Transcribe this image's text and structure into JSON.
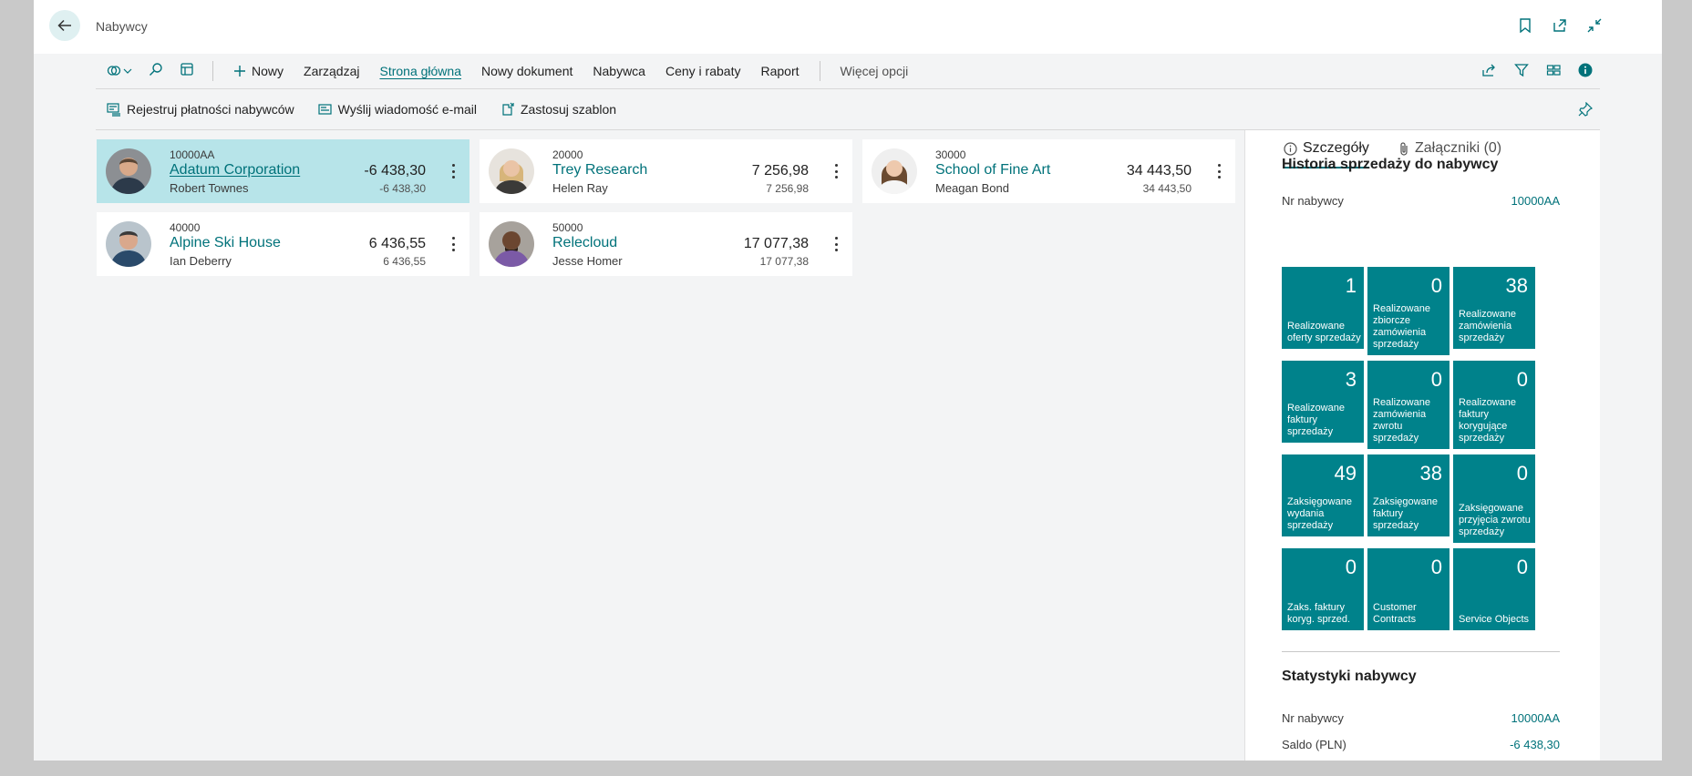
{
  "window": {
    "title": "Nabywcy"
  },
  "actions": {
    "new": "Nowy",
    "manage": "Zarządzaj",
    "home": "Strona główna",
    "new_document": "Nowy dokument",
    "customer": "Nabywca",
    "prices": "Ceny i rabaty",
    "report": "Raport",
    "more": "Więcej opcji"
  },
  "subactions": {
    "register_payments": "Rejestruj płatności nabywców",
    "send_email": "Wyślij wiadomość e-mail",
    "apply_template": "Zastosuj szablon"
  },
  "customers": [
    {
      "no": "10000AA",
      "name": "Adatum Corporation",
      "contact": "Robert Townes",
      "balance": "-6 438,30",
      "balance_due": "-6 438,30",
      "selected": true
    },
    {
      "no": "20000",
      "name": "Trey Research",
      "contact": "Helen Ray",
      "balance": "7 256,98",
      "balance_due": "7 256,98"
    },
    {
      "no": "30000",
      "name": "School of Fine Art",
      "contact": "Meagan Bond",
      "balance": "34 443,50",
      "balance_due": "34 443,50"
    },
    {
      "no": "40000",
      "name": "Alpine Ski House",
      "contact": "Ian Deberry",
      "balance": "6 436,55",
      "balance_due": "6 436,55"
    },
    {
      "no": "50000",
      "name": "Relecloud",
      "contact": "Jesse Homer",
      "balance": "17 077,38",
      "balance_due": "17 077,38"
    }
  ],
  "factbox": {
    "tab_details": "Szczegóły",
    "tab_attachments": "Załączniki (0)",
    "history_title": "Historia sprzedaży do nabywcy",
    "customer_no_label": "Nr nabywcy",
    "customer_no_value": "10000AA",
    "cues": [
      {
        "value": "1",
        "label": "Realizowane oferty sprzedaży"
      },
      {
        "value": "0",
        "label": "Realizowane zbiorcze zamówienia sprzedaży"
      },
      {
        "value": "38",
        "label": "Realizowane zamówienia sprzedaży"
      },
      {
        "value": "3",
        "label": "Realizowane faktury sprzedaży"
      },
      {
        "value": "0",
        "label": "Realizowane zamówienia zwrotu sprzedaży"
      },
      {
        "value": "0",
        "label": "Realizowane faktury korygujące sprzedaży"
      },
      {
        "value": "49",
        "label": "Zaksięgowane wydania sprzedaży"
      },
      {
        "value": "38",
        "label": "Zaksięgowane faktury sprzedaży"
      },
      {
        "value": "0",
        "label": "Zaksięgowane przyjęcia zwrotu sprzedaży"
      },
      {
        "value": "0",
        "label": "Zaks. faktury koryg. sprzed."
      },
      {
        "value": "0",
        "label": "Customer Contracts"
      },
      {
        "value": "0",
        "label": "Service Objects"
      }
    ],
    "stats_title": "Statystyki nabywcy",
    "stats_customer_no_label": "Nr nabywcy",
    "stats_customer_no_value": "10000AA",
    "balance_label": "Saldo (PLN)",
    "balance_value": "-6 438,30"
  },
  "colors": {
    "accent": "#00727a",
    "cue": "#00828b",
    "selected": "#b7e4e9"
  }
}
